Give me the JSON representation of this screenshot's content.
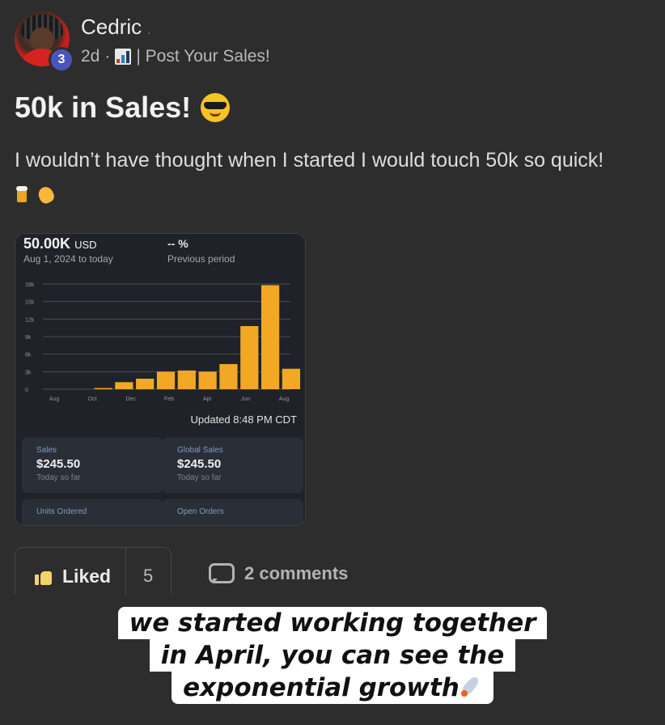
{
  "post": {
    "author": "Cedric",
    "author_suffix": ".",
    "level": "3",
    "time": "2d",
    "separator": "·",
    "category": "| Post Your Sales!",
    "title": "50k in Sales!",
    "body": "I wouldn’t have thought when I started I would touch 50k so quick!"
  },
  "sales_card": {
    "total": "50.00K",
    "currency": "USD",
    "date_range": "Aug 1, 2024 to today",
    "change": "-- %",
    "compare_label": "Previous period",
    "updated": "Updated 8:48 PM CDT",
    "stats": [
      {
        "label": "Sales",
        "value": "$245.50",
        "note": "Today so far"
      },
      {
        "label": "Global Sales",
        "value": "$245.50",
        "note": "Today so far"
      },
      {
        "label": "Units Ordered",
        "value": "",
        "note": ""
      },
      {
        "label": "Open Orders",
        "value": "",
        "note": ""
      }
    ]
  },
  "chart_data": {
    "type": "bar",
    "x_tick_labels": [
      "Aug",
      "Oct",
      "Dec",
      "Feb",
      "Apr",
      "Jun",
      "Aug"
    ],
    "y_tick_labels": [
      "0",
      "3k",
      "6k",
      "9k",
      "12k",
      "15k",
      "18k"
    ],
    "ylim": [
      0,
      18000
    ],
    "values": [
      0,
      0,
      200,
      1200,
      1800,
      3000,
      3200,
      3000,
      4300,
      10800,
      17800,
      3500
    ],
    "bar_color": "#f2a825",
    "grid": true
  },
  "actions": {
    "like_label": "Liked",
    "like_count": "5",
    "comments_label": "2 comments"
  },
  "caption": {
    "lines": [
      "we started working together",
      "in April, you can see the",
      "exponential growth"
    ]
  }
}
